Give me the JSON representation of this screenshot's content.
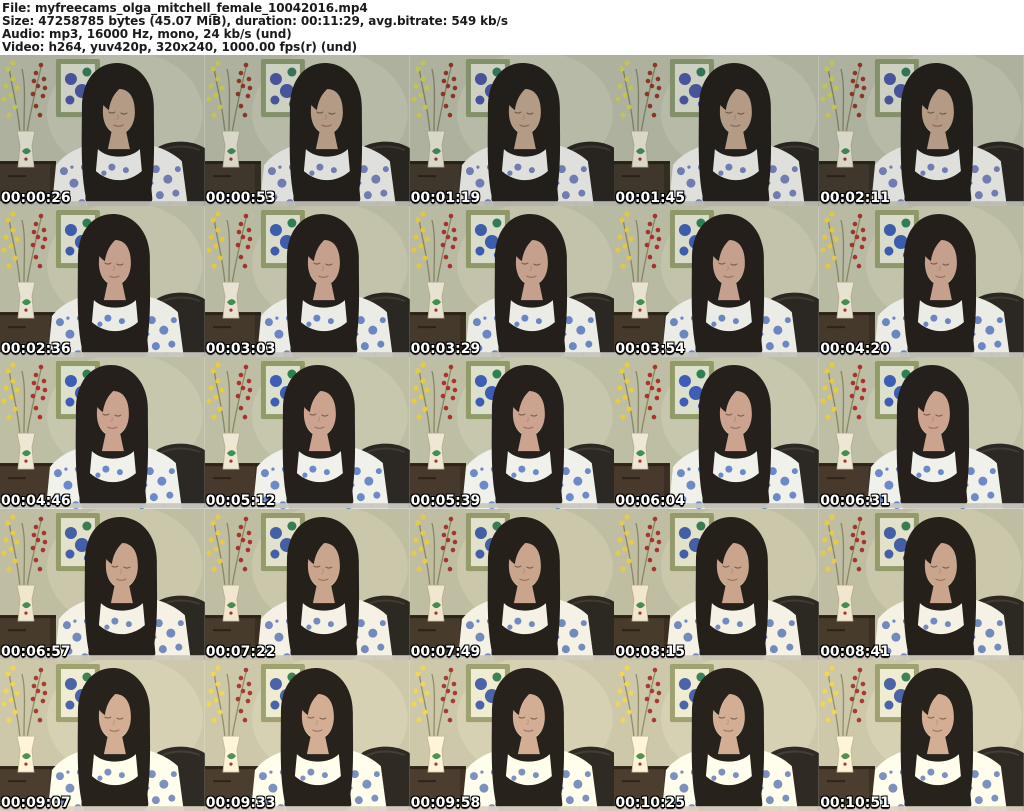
{
  "header": {
    "lines": [
      "File: myfreecams_olga_mitchell_female_10042016.mp4",
      "Size: 47258785 bytes (45.07 MiB), duration: 00:11:29, avg.bitrate: 549 kb/s",
      "Audio: mp3, 16000 Hz, mono, 24 kb/s (und)",
      "Video: h264, yuv420p, 320x240, 1000.00 fps(r) (und)"
    ]
  },
  "thumbnails": {
    "count": 25,
    "timestamps": [
      "00:00:26",
      "00:00:53",
      "00:01:19",
      "00:01:45",
      "00:02:11",
      "00:02:36",
      "00:03:03",
      "00:03:29",
      "00:03:54",
      "00:04:20",
      "00:04:46",
      "00:05:12",
      "00:05:39",
      "00:06:04",
      "00:06:31",
      "00:06:57",
      "00:07:22",
      "00:07:49",
      "00:08:15",
      "00:08:41",
      "00:09:07",
      "00:09:33",
      "00:09:58",
      "00:10:25",
      "00:10:51"
    ]
  },
  "palette": {
    "page_bg": "#ffffff",
    "header_text": "#1a1a1a",
    "timestamp_text": "#ffffff",
    "timestamp_outline": "#000000",
    "wall": "#b9baa1",
    "hair": "#251f1b",
    "skin": "#c7a08b",
    "shirt": "#ebece6",
    "shirt_pattern": "#5574bd",
    "chair": "#2b2722",
    "cabinet": "#46392b",
    "frame_border": "#8e9866",
    "frame_blue": "#3c5cb0",
    "flower_yellow": "#e2c83e",
    "flower_red": "#a8322b",
    "vase": "#e8e2cf",
    "desk": "#c6c5bc"
  }
}
